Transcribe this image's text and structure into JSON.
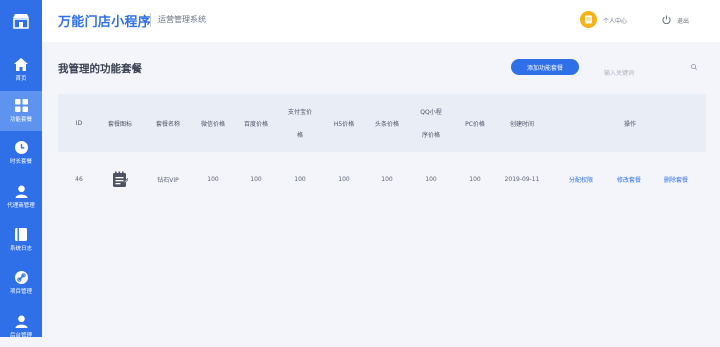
{
  "sidebar": {
    "items": [
      {
        "label": "首页",
        "icon": "home-icon"
      },
      {
        "label": "功能套餐",
        "icon": "grid-icon",
        "active": true
      },
      {
        "label": "时长套餐",
        "icon": "clock-icon"
      },
      {
        "label": "代理商管理",
        "icon": "user-icon"
      },
      {
        "label": "系统日志",
        "icon": "book-icon"
      },
      {
        "label": "项目管理",
        "icon": "link-icon"
      },
      {
        "label": "后台管理",
        "icon": "user-icon"
      }
    ]
  },
  "header": {
    "title": "万能门店小程序",
    "subtitle": "运营管理系统",
    "user_label": "个人中心",
    "logout_label": "退出"
  },
  "main": {
    "page_title": "我管理的功能套餐",
    "add_button": "添加功能套餐",
    "search_placeholder": "输入关键词"
  },
  "table": {
    "headers": [
      {
        "l1": "ID"
      },
      {
        "l1": "套餐图标"
      },
      {
        "l1": "套餐名称"
      },
      {
        "l1": "微信价格"
      },
      {
        "l1": "百度价格"
      },
      {
        "l1": "支付宝价",
        "l2": "格"
      },
      {
        "l1": "H5价格"
      },
      {
        "l1": "头条价格"
      },
      {
        "l1": "QQ小程",
        "l2": "序价格"
      },
      {
        "l1": "PC价格"
      },
      {
        "l1": "创建时间"
      },
      {
        "l1": "操作"
      }
    ],
    "rows": [
      {
        "id": "46",
        "icon": "notepad-icon",
        "name": "钻石VIP",
        "wechat": "100",
        "baidu": "100",
        "alipay": "100",
        "h5": "100",
        "toutiao": "100",
        "qq": "100",
        "pc": "100",
        "created": "2019-09-11",
        "actions": [
          "分配权限",
          "修改套餐",
          "删除套餐"
        ]
      }
    ]
  },
  "colors": {
    "accent": "#2f6fe8",
    "sidebar_bg": "#2f6fe8",
    "sidebar_active": "#5f93f0",
    "page_bg": "#f3f5fa",
    "table_header_bg": "#e9edf6",
    "avatar": "#f5b21a"
  }
}
